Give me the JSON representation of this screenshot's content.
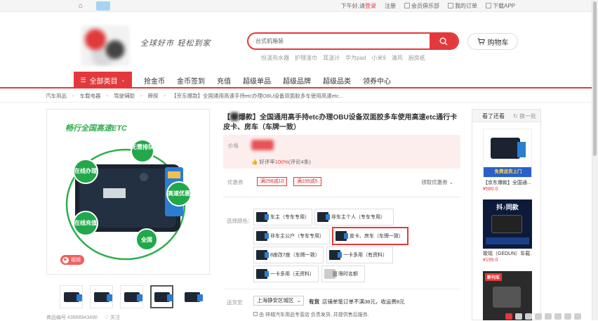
{
  "topbar": {
    "greeting": "下午好,请",
    "login": "登录",
    "register": "注册",
    "vip": "会员俱乐部",
    "orders": "我的订单",
    "app": "下载APP"
  },
  "header": {
    "slogan": "全球好市 轻松到家",
    "search_value": "台式机箱装",
    "cart_label": "购物车",
    "hotwords": [
      "恒温热水器",
      "护理湿巾",
      "耳温计",
      "华为pad",
      "小米9",
      "清风",
      "厨房纸"
    ]
  },
  "nav": {
    "all_categories": "全部类目",
    "items": [
      "抢金币",
      "金币签到",
      "充值",
      "超级单品",
      "超级品牌",
      "超级品类",
      "领券中心"
    ]
  },
  "breadcrumb": [
    "汽车用品",
    "车载电器",
    "驾驶辅助",
    "蹄探",
    "【京东爆款】全国通用高速手持etc办理OBU设备双面胶多车使用高速etc..."
  ],
  "product": {
    "banner_text": "畅行全国高速ETC",
    "bubbles": [
      "无需排队",
      "在线办理",
      "高速优惠",
      "在线充值",
      "全国"
    ],
    "video_label": "视频",
    "title_prefix": "【",
    "title_rest": "爆款】全国通用高手持etc办理OBU设备双面胶多车使用高速etc通行卡皮卡、房车（车牌一致）",
    "price_label": "价格",
    "good_rate_label": "好评率",
    "good_rate_value": "100%",
    "review_count": "(评论4条)",
    "coupon_label": "优惠券",
    "coupons": [
      "满298减10",
      "满199减5"
    ],
    "coupon_more": "领取优惠券",
    "color_label": "选择颜色：",
    "options": [
      {
        "label": "车主（专车专用）",
        "selected": false
      },
      {
        "label": "非车主个人（专车专用）",
        "selected": false
      },
      {
        "label": "非车主公户（专车专用）",
        "selected": false
      },
      {
        "label": "皮卡、房车（车牌一致）",
        "selected": true
      },
      {
        "label": "8座改7座（车牌一致）",
        "selected": false
      },
      {
        "label": "一卡多用（有资料）",
        "selected": false
      },
      {
        "label": "一卡多用（无资料）",
        "selected": false
      },
      {
        "label": "限时名额",
        "selected": false
      }
    ],
    "ship_label": "送货至",
    "region": "上海静安区城区",
    "stock": "有货",
    "stock_note": "店铺单笔订单不满38元，收运费8元",
    "service": "由 祥城汽车用品专营店 负责发货, 并提供售后服务."
  },
  "footer": {
    "code_label": "商品编号",
    "code": "43868943490",
    "follow": "关注"
  },
  "see_also": {
    "title": "看了还看",
    "refresh": "换一批",
    "items": [
      {
        "caption": "【京东爆款】全国通...",
        "price": "¥580.0",
        "overlay": "免费送货上门"
      },
      {
        "caption": "歌瑶（GEDUN）车载...",
        "price": "¥199.0",
        "overlay": "抖♪同款"
      },
      {
        "caption": "",
        "price": "",
        "overlay": "新刊车"
      }
    ]
  }
}
